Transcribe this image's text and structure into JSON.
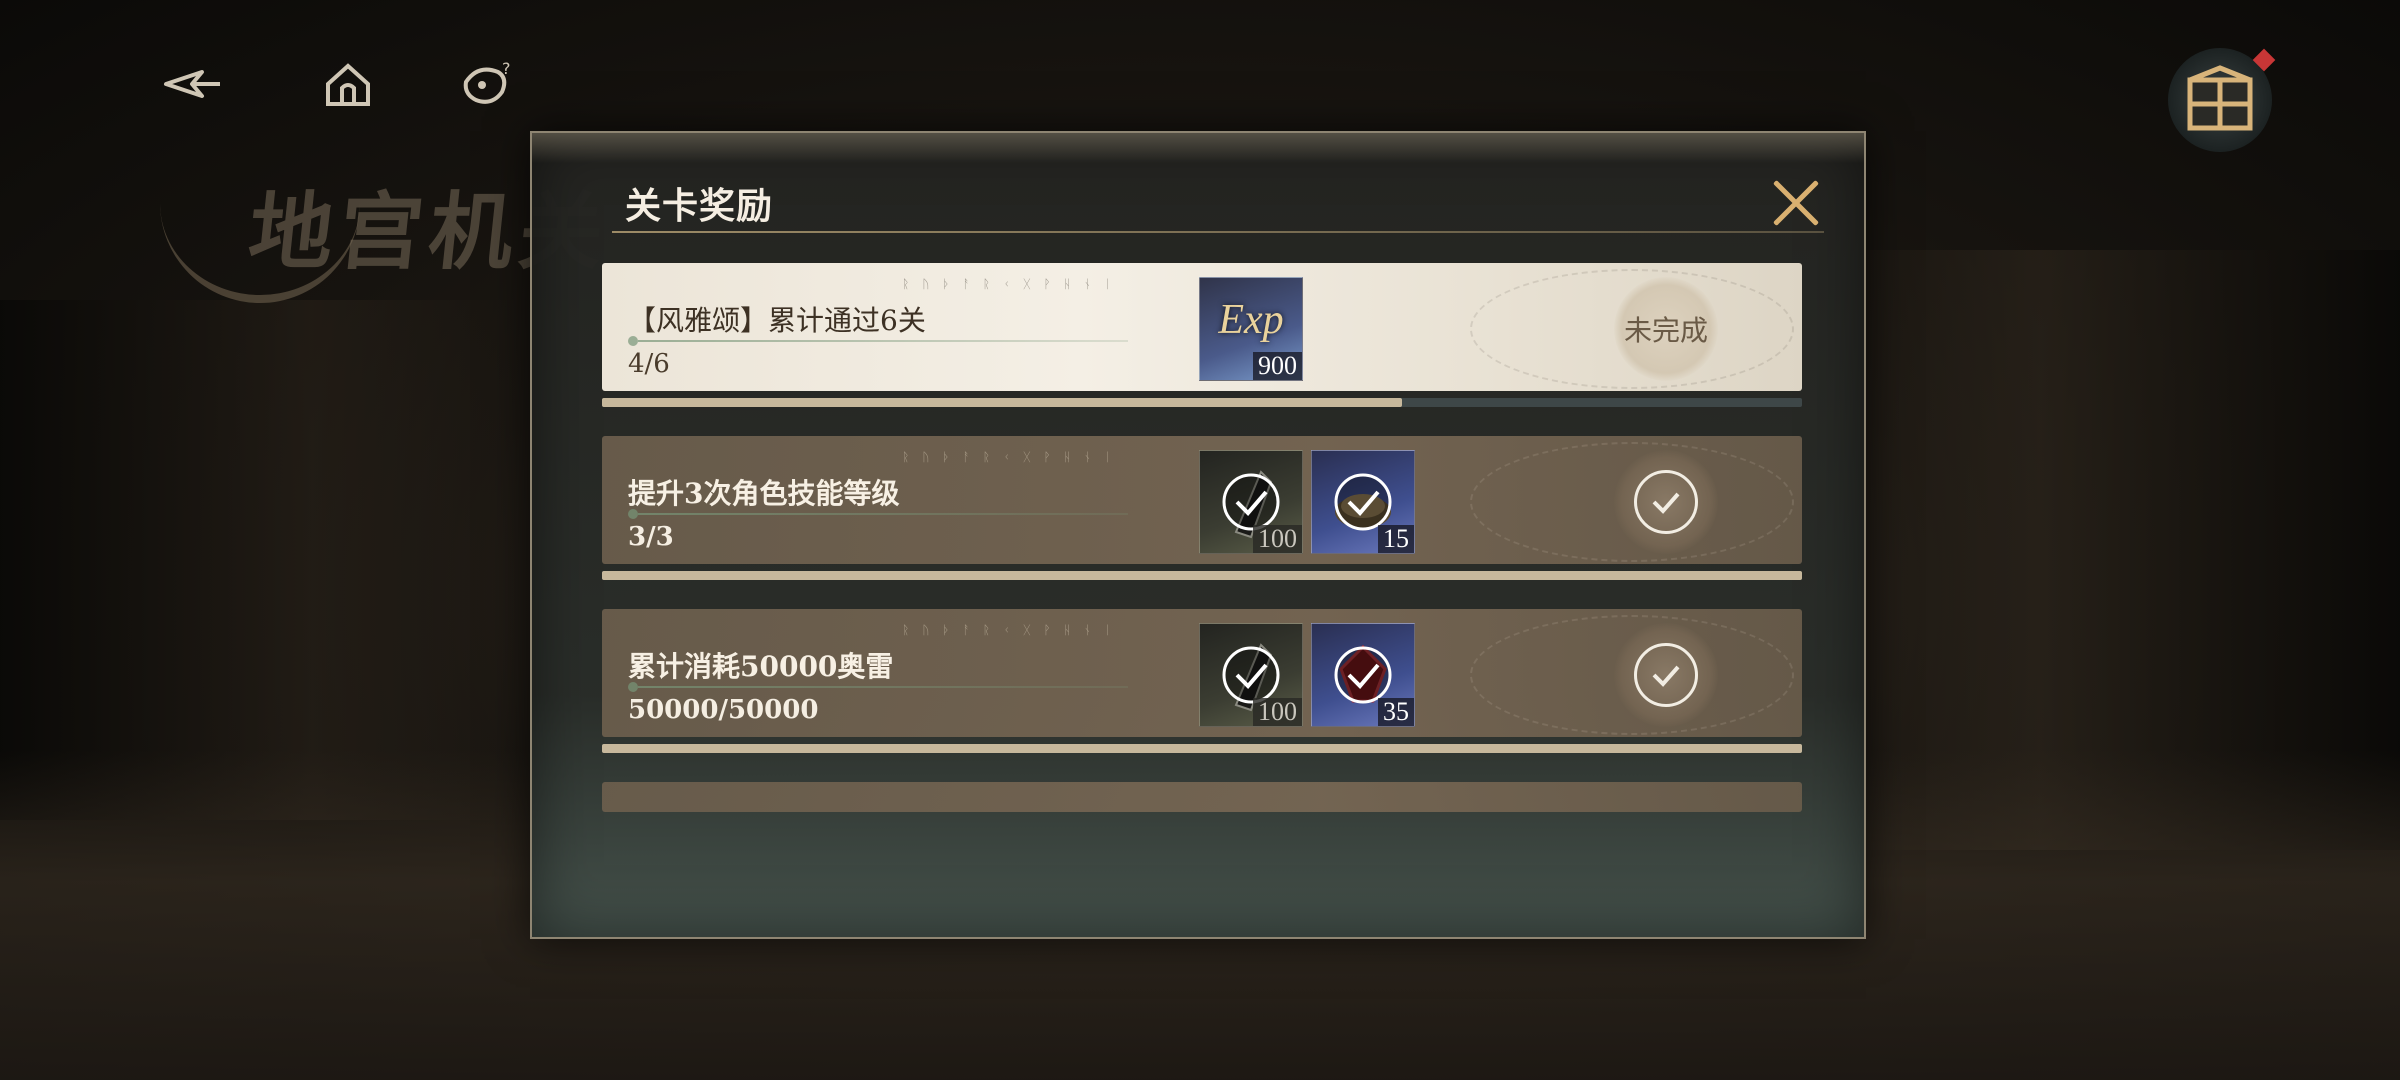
{
  "background": {
    "scene_title": "地宫机关"
  },
  "nav": {
    "back_icon": "back-arrow-icon",
    "home_icon": "home-icon",
    "help_icon": "help-icon",
    "corner_icon": "treasure-box-icon"
  },
  "dialog": {
    "title": "关卡奖励",
    "close_icon": "close-icon",
    "tasks": [
      {
        "name": "【风雅颂】累计通过6关",
        "progress_text": "4/6",
        "progress": 0.667,
        "status": "未完成",
        "completed": false,
        "rewards": [
          {
            "icon": "exp-icon",
            "label": "Exp",
            "qty": "900",
            "claimed": false
          }
        ]
      },
      {
        "name": "提升3次角色技能等级",
        "progress_text": "3/3",
        "progress": 1.0,
        "status": "completed",
        "completed": true,
        "rewards": [
          {
            "icon": "gear-material-icon",
            "qty": "100",
            "claimed": true
          },
          {
            "icon": "bell-item-icon",
            "qty": "15",
            "claimed": true
          }
        ]
      },
      {
        "name": "累计消耗50000奥雷",
        "progress_text": "50000/50000",
        "progress": 1.0,
        "status": "completed",
        "completed": true,
        "rewards": [
          {
            "icon": "gear-material-icon",
            "qty": "100",
            "claimed": true
          },
          {
            "icon": "red-gem-icon",
            "qty": "35",
            "claimed": true
          }
        ]
      }
    ]
  },
  "colors": {
    "accent_gold": "#d9b070",
    "progress_fill": "#c7b89c",
    "progress_track": "#3e4748",
    "notification": "#c83636"
  }
}
